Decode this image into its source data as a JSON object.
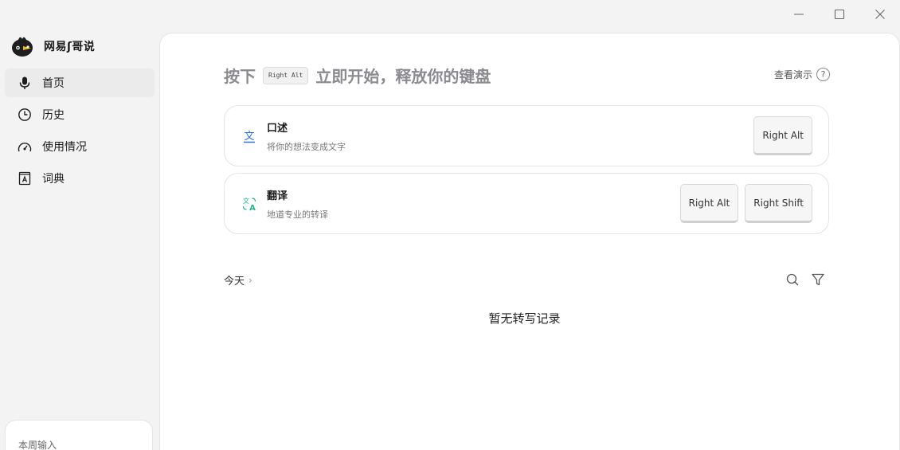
{
  "app": {
    "name": "网易ʃ哥说"
  },
  "window": {
    "minimize": "minimize",
    "maximize": "maximize",
    "close": "close"
  },
  "sidebar": {
    "items": [
      {
        "label": "首页",
        "icon": "mic-icon",
        "active": true
      },
      {
        "label": "历史",
        "icon": "clock-icon",
        "active": false
      },
      {
        "label": "使用情况",
        "icon": "gauge-icon",
        "active": false
      },
      {
        "label": "词典",
        "icon": "dictionary-icon",
        "active": false
      }
    ],
    "weekly_label": "本周输入"
  },
  "hero": {
    "prefix": "按下",
    "key": "Right Alt",
    "suffix": "立即开始，释放你的键盘"
  },
  "demo_link": {
    "label": "查看演示",
    "icon": "?"
  },
  "modes": [
    {
      "title": "口述",
      "subtitle": "将你的想法变成文字",
      "icon": "text-icon",
      "keys": [
        "Right Alt"
      ]
    },
    {
      "title": "翻译",
      "subtitle": "地道专业的转译",
      "icon": "translate-icon",
      "keys": [
        "Right Alt",
        "Right Shift"
      ]
    }
  ],
  "history": {
    "section_label": "今天",
    "chevron": "›",
    "empty_text": "暂无转写记录"
  },
  "colors": {
    "accent_blue": "#2f6fe0",
    "accent_green": "#1fb48a"
  }
}
